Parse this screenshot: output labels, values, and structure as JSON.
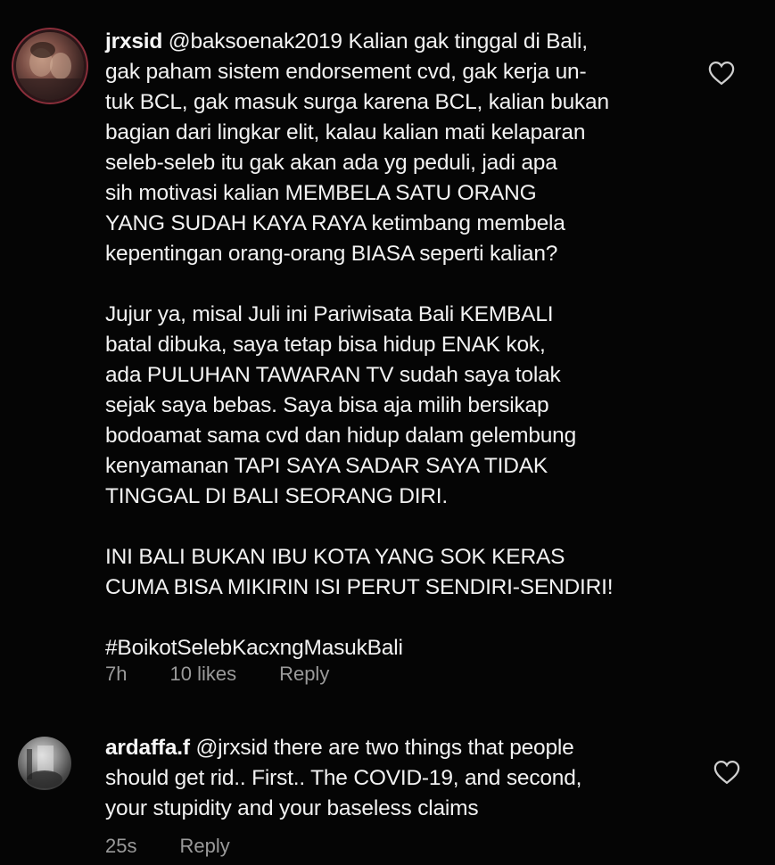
{
  "comments": [
    {
      "username": "jrxsid",
      "paragraphs": [
        "@baksoenak2019 Kalian gak tinggal di Bali,\ngak paham sistem endorsement cvd, gak kerja un-\ntuk BCL, gak masuk surga karena BCL, kalian bukan\nbagian dari lingkar elit, kalau kalian mati kelaparan\nseleb-seleb itu gak akan ada yg peduli, jadi apa\nsih motivasi kalian MEMBELA SATU ORANG\nYANG SUDAH KAYA RAYA ketimbang membela\nkepentingan orang-orang BIASA seperti kalian?",
        "Jujur ya, misal Juli ini Pariwisata Bali KEMBALI\nbatal dibuka, saya tetap bisa hidup ENAK kok,\nada PULUHAN TAWARAN TV sudah saya tolak\nsejak saya bebas. Saya bisa aja milih bersikap\nbodoamat sama cvd dan hidup dalam gelembung\nkenyamanan TAPI SAYA SADAR SAYA TIDAK\nTINGGAL DI BALI SEORANG DIRI.",
        "INI BALI BUKAN IBU KOTA YANG SOK KERAS\nCUMA BISA MIKIRIN ISI PERUT SENDIRI-SENDIRI!",
        "#BoikotSelebKacxngMasukBali"
      ],
      "time": "7h",
      "likes": "10 likes",
      "reply_label": "Reply"
    },
    {
      "username": "ardaffa.f",
      "paragraphs": [
        "@jrxsid there are two things that people\nshould get rid.. First.. The COVID-19, and second,\nyour stupidity and your baseless claims"
      ],
      "time": "25s",
      "reply_label": "Reply"
    }
  ],
  "colors": {
    "background": "#050505",
    "text": "#f2f2f2",
    "meta": "#9a9a9a"
  },
  "icons": {
    "like": "heart-outline-icon"
  }
}
